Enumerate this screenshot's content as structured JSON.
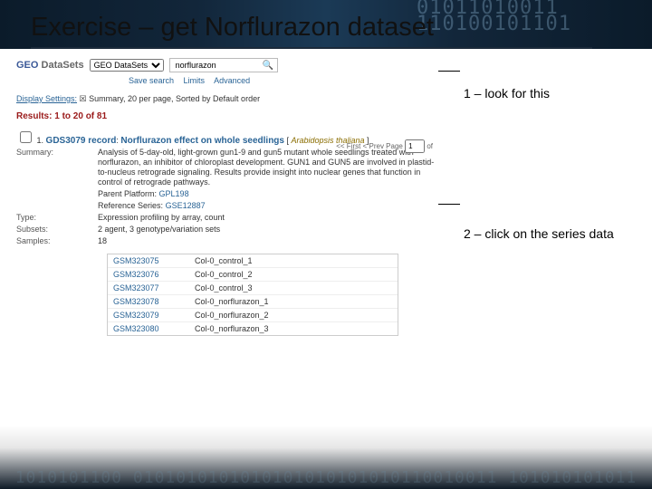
{
  "slide": {
    "title": "Exercise – get Norflurazon dataset",
    "annotation1": "1 – look for this",
    "annotation2": "2 – click on the series data"
  },
  "geo": {
    "brand_prefix": "GEO",
    "brand_suffix": " DataSets",
    "scope_selected": "GEO DataSets",
    "search_value": "norflurazon",
    "links": {
      "save": "Save search",
      "limits": "Limits",
      "advanced": "Advanced"
    },
    "display_label": "Display Settings:",
    "display_text": "Summary, 20 per page, Sorted by Default order",
    "results_header": "Results: 1 to 20 of 81",
    "pager": {
      "prev": "<< First",
      "prev2": "< Prev",
      "page_label": "Page",
      "page_value": "1",
      "of": "of"
    },
    "record": {
      "index": "1.",
      "accession": "GDS3079 record",
      "title": "Norflurazon effect on whole seedlings",
      "organism": "Arabidopsis thaliana",
      "summary_label": "Summary:",
      "summary_text": "Analysis of 5-day-old, light-grown gun1-9 and gun5 mutant whole seedlings treated with norflurazon, an inhibitor of chloroplast development. GUN1 and GUN5 are involved in plastid-to-nucleus retrograde signaling. Results provide insight into nuclear genes that function in control of retrograde pathways.",
      "platform_label": "Parent Platform:",
      "platform_link": "GPL198",
      "series_label": "Reference Series:",
      "series_link": "GSE12887",
      "type_label": "Type:",
      "type_value": "Expression profiling by array, count",
      "subsets_label": "Subsets:",
      "subsets_value": "2 agent, 3 genotype/variation sets",
      "samples_label": "Samples:",
      "samples_count": "18"
    },
    "samples": [
      {
        "gsm": "GSM323075",
        "name": "Col-0_control_1"
      },
      {
        "gsm": "GSM323076",
        "name": "Col-0_control_2"
      },
      {
        "gsm": "GSM323077",
        "name": "Col-0_control_3"
      },
      {
        "gsm": "GSM323078",
        "name": "Col-0_norflurazon_1"
      },
      {
        "gsm": "GSM323079",
        "name": "Col-0_norflurazon_2"
      },
      {
        "gsm": "GSM323080",
        "name": "Col-0_norflurazon_3"
      }
    ]
  },
  "decor": {
    "top_bits": "01011010011\n110100101101",
    "bottom_bits": "1010101100 0101010101010101010101010110010011 101010101011"
  }
}
